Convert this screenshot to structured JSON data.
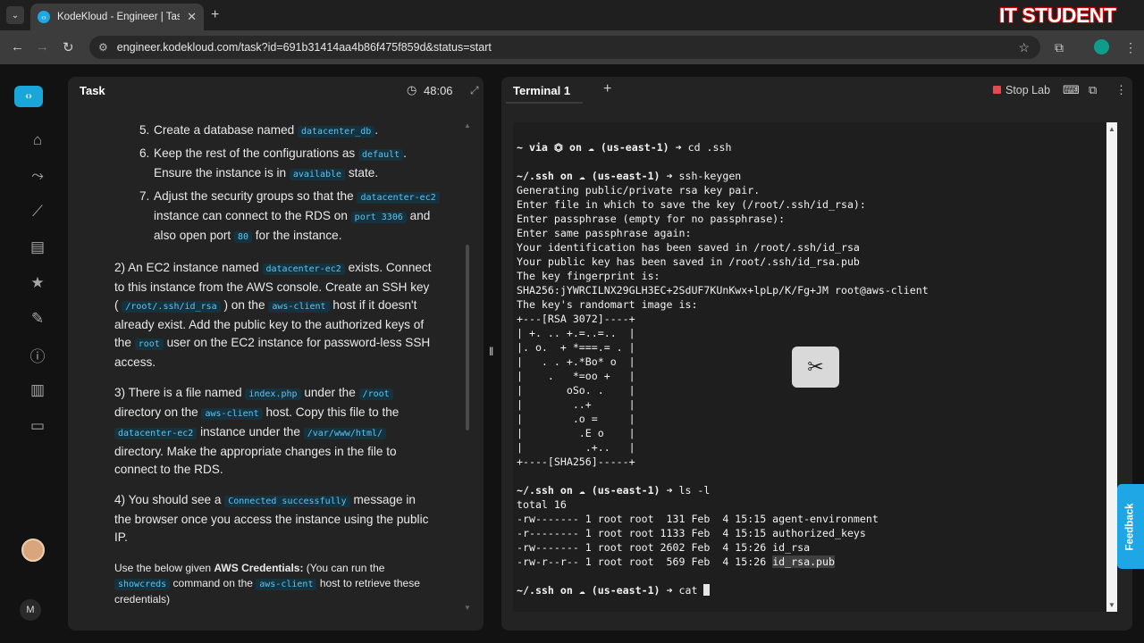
{
  "browser": {
    "tab_title": "KodeKloud - Engineer | Task",
    "url": "engineer.kodekloud.com/task?id=691b31414aa4b86f475f859d&status=start",
    "overlay_brand": "IT STUDENT"
  },
  "task": {
    "header": "Task",
    "timer": "48:06",
    "steps": [
      {
        "num": "5.",
        "before": "Create a database named",
        "code": "datacenter_db",
        "after": "."
      },
      {
        "num": "6.",
        "before": "Keep the rest of the configurations as",
        "code": "default",
        "after": ".",
        "line2_before": "Ensure the instance is in",
        "line2_code": "available",
        "line2_after": "state."
      },
      {
        "num": "7.",
        "before": "Adjust the security groups so that the",
        "code1": "datacenter-ec2",
        "mid": "instance can connect to the RDS on",
        "code2": "port 3306",
        "mid2": "and also open port",
        "code3": "80",
        "after": "for the instance."
      }
    ],
    "para2": {
      "a": "2) An EC2 instance named",
      "code1": "datacenter-ec2",
      "b": "exists. Connect to this instance from the AWS console. Create an SSH key (",
      "code2": "/root/.ssh/id_rsa",
      "c": ") on the",
      "code3": "aws-client",
      "d": "host if it doesn't already exist. Add the public key to the authorized keys of the",
      "code4": "root",
      "e": "user on the EC2 instance for password-less SSH access."
    },
    "para3": {
      "a": "3) There is a file named",
      "code1": "index.php",
      "b": "under the",
      "code2": "/root",
      "c": "directory on the",
      "code3": "aws-client",
      "d": "host. Copy this file to the",
      "code4": "datacenter-ec2",
      "e": "instance under the",
      "code5": "/var/www/html/",
      "f": "directory. Make the appropriate changes in the file to connect to the RDS."
    },
    "para4": {
      "a": "4) You should see a",
      "code1": "Connected successfully",
      "b": "message in the browser once you access the instance using the public IP."
    },
    "para5": {
      "a": "Use the below given",
      "bold": "AWS Credentials:",
      "b": "(You can run the",
      "code1": "showcreds",
      "c": "command on the",
      "code2": "aws-client",
      "d": "host to retrieve these credentials)"
    }
  },
  "terminal": {
    "tab_label": "Terminal 1",
    "stop_label": "Stop Lab",
    "lines": [
      {
        "prompt": "~ via ⏣ on ☁ (us-east-1) ➜ ",
        "cmd": "cd .ssh"
      },
      {
        "text": ""
      },
      {
        "prompt": "~/.ssh on ☁ (us-east-1) ➜ ",
        "cmd": "ssh-keygen"
      },
      {
        "text": "Generating public/private rsa key pair."
      },
      {
        "text": "Enter file in which to save the key (/root/.ssh/id_rsa):"
      },
      {
        "text": "Enter passphrase (empty for no passphrase):"
      },
      {
        "text": "Enter same passphrase again:"
      },
      {
        "text": "Your identification has been saved in /root/.ssh/id_rsa"
      },
      {
        "text": "Your public key has been saved in /root/.ssh/id_rsa.pub"
      },
      {
        "text": "The key fingerprint is:"
      },
      {
        "text": "SHA256:jYWRCILNX29GLH3EC+2SdUF7KUnKwx+lpLp/K/Fg+JM root@aws-client"
      },
      {
        "text": "The key's randomart image is:"
      },
      {
        "text": "+---[RSA 3072]----+"
      },
      {
        "text": "| +. .. +.=..=..  |"
      },
      {
        "text": "|. o.  + *===.= . |"
      },
      {
        "text": "|   . . +.*Bo* o  |"
      },
      {
        "text": "|    .   *=oo +   |"
      },
      {
        "text": "|       oSo. .    |"
      },
      {
        "text": "|        ..+      |"
      },
      {
        "text": "|        .o =     |"
      },
      {
        "text": "|         .E o    |"
      },
      {
        "text": "|          .+..   |"
      },
      {
        "text": "+----[SHA256]-----+"
      },
      {
        "text": ""
      },
      {
        "prompt": "~/.ssh on ☁ (us-east-1) ➜ ",
        "cmd": "ls -l"
      },
      {
        "text": "total 16"
      },
      {
        "text": "-rw------- 1 root root  131 Feb  4 15:15 agent-environment"
      },
      {
        "text": "-r-------- 1 root root 1133 Feb  4 15:15 authorized_keys"
      },
      {
        "text": "-rw------- 1 root root 2602 Feb  4 15:26 id_rsa"
      },
      {
        "text": "-rw-r--r-- 1 root root  569 Feb  4 15:26 ",
        "highlight": "id_rsa.pub"
      },
      {
        "text": ""
      },
      {
        "prompt": "~/.ssh on ☁ (us-east-1) ➜ ",
        "cmd": "cat ",
        "cursor": true
      }
    ]
  },
  "feedback_label": "Feedback",
  "user_initial": "M"
}
